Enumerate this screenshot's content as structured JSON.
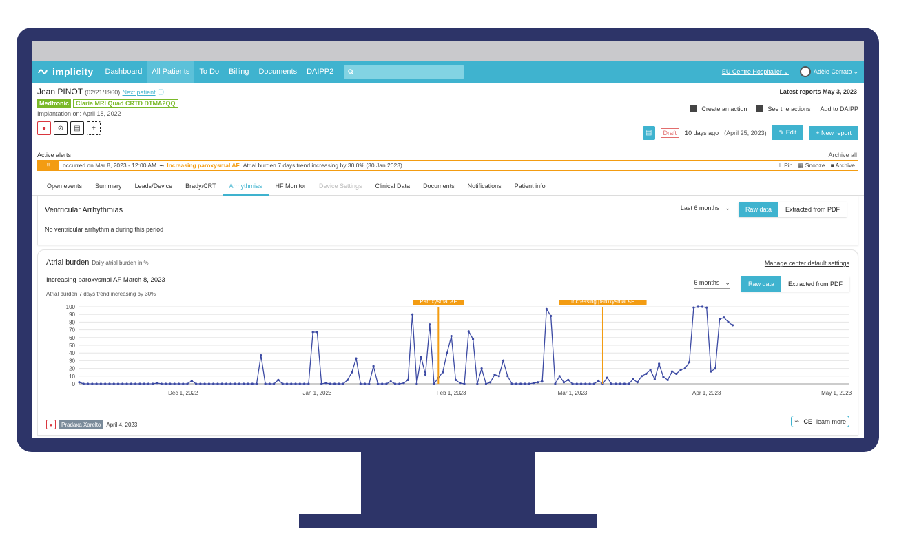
{
  "nav": {
    "logo": "implicity",
    "items": [
      "Dashboard",
      "All Patients",
      "To Do",
      "Billing",
      "Documents",
      "DAIPP2"
    ],
    "active_index": 1,
    "center": "EU Centre Hospitalier",
    "user": "Adèle Cerrato"
  },
  "patient": {
    "name": "Jean PINOT",
    "dob": "(02/21/1960)",
    "next_link": "Next patient",
    "brand": "Medtronic",
    "model": "Claria MRI Quad CRTD DTMA2QQ",
    "implantation": "Implantation on: April 18, 2022",
    "latest_reports": "Latest reports May 3, 2023",
    "create_action": "Create an action",
    "see_actions": "See the actions",
    "add_daipp": "Add to DAIPP",
    "draft": "Draft",
    "days_ago": "10 days ago",
    "report_date": "(April 25, 2023)",
    "edit": "Edit",
    "new_report": "New report"
  },
  "alerts": {
    "title": "Active alerts",
    "archive_all": "Archive all",
    "count": "!!",
    "occurred": "occurred on Mar 8, 2023 - 12:00 AM",
    "type": "Increasing paroxysmal AF",
    "desc": "Atrial burden 7 days trend increasing by 30.0% (30 Jan 2023)",
    "pin": "Pin",
    "snooze": "Snooze",
    "archive": "Archive"
  },
  "tabs": [
    {
      "label": "Open events",
      "state": "normal"
    },
    {
      "label": "Summary",
      "state": "normal"
    },
    {
      "label": "Leads/Device",
      "state": "normal"
    },
    {
      "label": "Brady/CRT",
      "state": "normal"
    },
    {
      "label": "Arrhythmias",
      "state": "active"
    },
    {
      "label": "HF Monitor",
      "state": "normal"
    },
    {
      "label": "Device Settings",
      "state": "disabled"
    },
    {
      "label": "Clinical Data",
      "state": "normal"
    },
    {
      "label": "Documents",
      "state": "normal"
    },
    {
      "label": "Notifications",
      "state": "normal"
    },
    {
      "label": "Patient info",
      "state": "normal"
    }
  ],
  "ventricular": {
    "title": "Ventricular Arrhythmias",
    "range": "Last 6 months",
    "raw": "Raw data",
    "pdf": "Extracted from PDF",
    "message": "No ventricular arrhythmia during this period"
  },
  "atrial": {
    "title": "Atrial burden",
    "subtitle": "Daily atrial burden in %",
    "manage": "Manage center default settings",
    "alert_title": "Increasing paroxysmal AF March 8, 2023",
    "alert_desc": "Atrial burden 7 days trend increasing by 30%",
    "range": "6 months",
    "raw": "Raw data",
    "pdf": "Extracted from PDF",
    "drug": "Pradaxa Xarelto",
    "drug_date": "April 4, 2023",
    "learn": "learn more"
  },
  "chart_data": {
    "type": "line",
    "ylim": [
      0,
      100
    ],
    "yticks": [
      0,
      10,
      20,
      30,
      40,
      50,
      60,
      70,
      80,
      90,
      100
    ],
    "xlim": [
      0,
      160
    ],
    "xticks": [
      {
        "x": 24,
        "label": "Dec 1, 2022"
      },
      {
        "x": 55,
        "label": "Jan 1, 2023"
      },
      {
        "x": 86,
        "label": "Feb 1, 2023"
      },
      {
        "x": 114,
        "label": "Mar 1, 2023"
      },
      {
        "x": 145,
        "label": "Apr 1, 2023"
      },
      {
        "x": 175,
        "label": "May 1, 2023"
      }
    ],
    "annotations": [
      {
        "x": 83,
        "label": "Paroxysmal AF"
      },
      {
        "x": 121,
        "label": "Increasing paroxysmal AF"
      }
    ],
    "colors": {
      "line": "#3c4aa3",
      "annotation": "#f39c12"
    },
    "series": [
      {
        "values": [
          2,
          0,
          0,
          0,
          0,
          0,
          0,
          0,
          0,
          0,
          0,
          0,
          0,
          0,
          0,
          0,
          0,
          0,
          1,
          0,
          0,
          0,
          0,
          0,
          0,
          0,
          4,
          0,
          0,
          0,
          0,
          0,
          0,
          0,
          0,
          0,
          0,
          0,
          0,
          0,
          0,
          0,
          37,
          0,
          0,
          0,
          5,
          0,
          0,
          0,
          0,
          0,
          0,
          0,
          67,
          67,
          0,
          1,
          0,
          0,
          0,
          0,
          5,
          15,
          33,
          0,
          0,
          0,
          23,
          0,
          0,
          0,
          3,
          0,
          0,
          1,
          5,
          90,
          0,
          35,
          12,
          77,
          0,
          8,
          15,
          40,
          62,
          5,
          1,
          0,
          68,
          58,
          0,
          20,
          0,
          2,
          12,
          10,
          30,
          10,
          0,
          0,
          0,
          0,
          0,
          1,
          2,
          3,
          97,
          88,
          0,
          10,
          2,
          5,
          0,
          0,
          0,
          0,
          0,
          0,
          4,
          0,
          8,
          0,
          0,
          0,
          0,
          0,
          6,
          2,
          10,
          13,
          18,
          6,
          26,
          9,
          5,
          16,
          13,
          18,
          20,
          28,
          99,
          100,
          100,
          99,
          16,
          20,
          84,
          86,
          80,
          76
        ]
      }
    ]
  }
}
